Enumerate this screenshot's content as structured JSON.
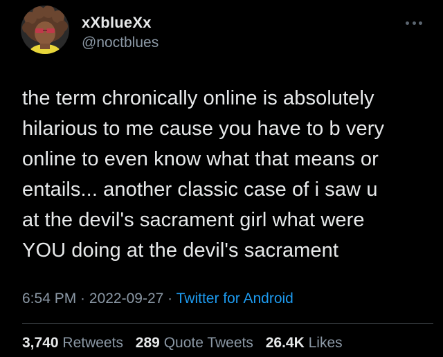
{
  "user": {
    "display_name": "xXblueXx",
    "handle": "@noctblues",
    "avatar_icon": "profile-photo"
  },
  "tweet": {
    "text": "the term chronically online is absolutely\nhilarious to me cause you have to b very\nonline to even know what that means or\nentails... another classic case of i saw u\nat the devil's sacrament girl what were\nYOU doing at the devil's sacrament"
  },
  "meta": {
    "time": "6:54 PM",
    "separator1": " · ",
    "date": "2022-09-27",
    "separator2": " · ",
    "source": "Twitter for Android"
  },
  "stats": {
    "retweets_count": "3,740",
    "retweets_label": "Retweets",
    "quotes_count": "289",
    "quotes_label": "Quote Tweets",
    "likes_count": "26.4K",
    "likes_label": "Likes"
  },
  "colors": {
    "background": "#000000",
    "text": "#e7e9ea",
    "secondary": "#8b98a5",
    "link": "#1d9bf0",
    "divider": "#2f3336"
  }
}
